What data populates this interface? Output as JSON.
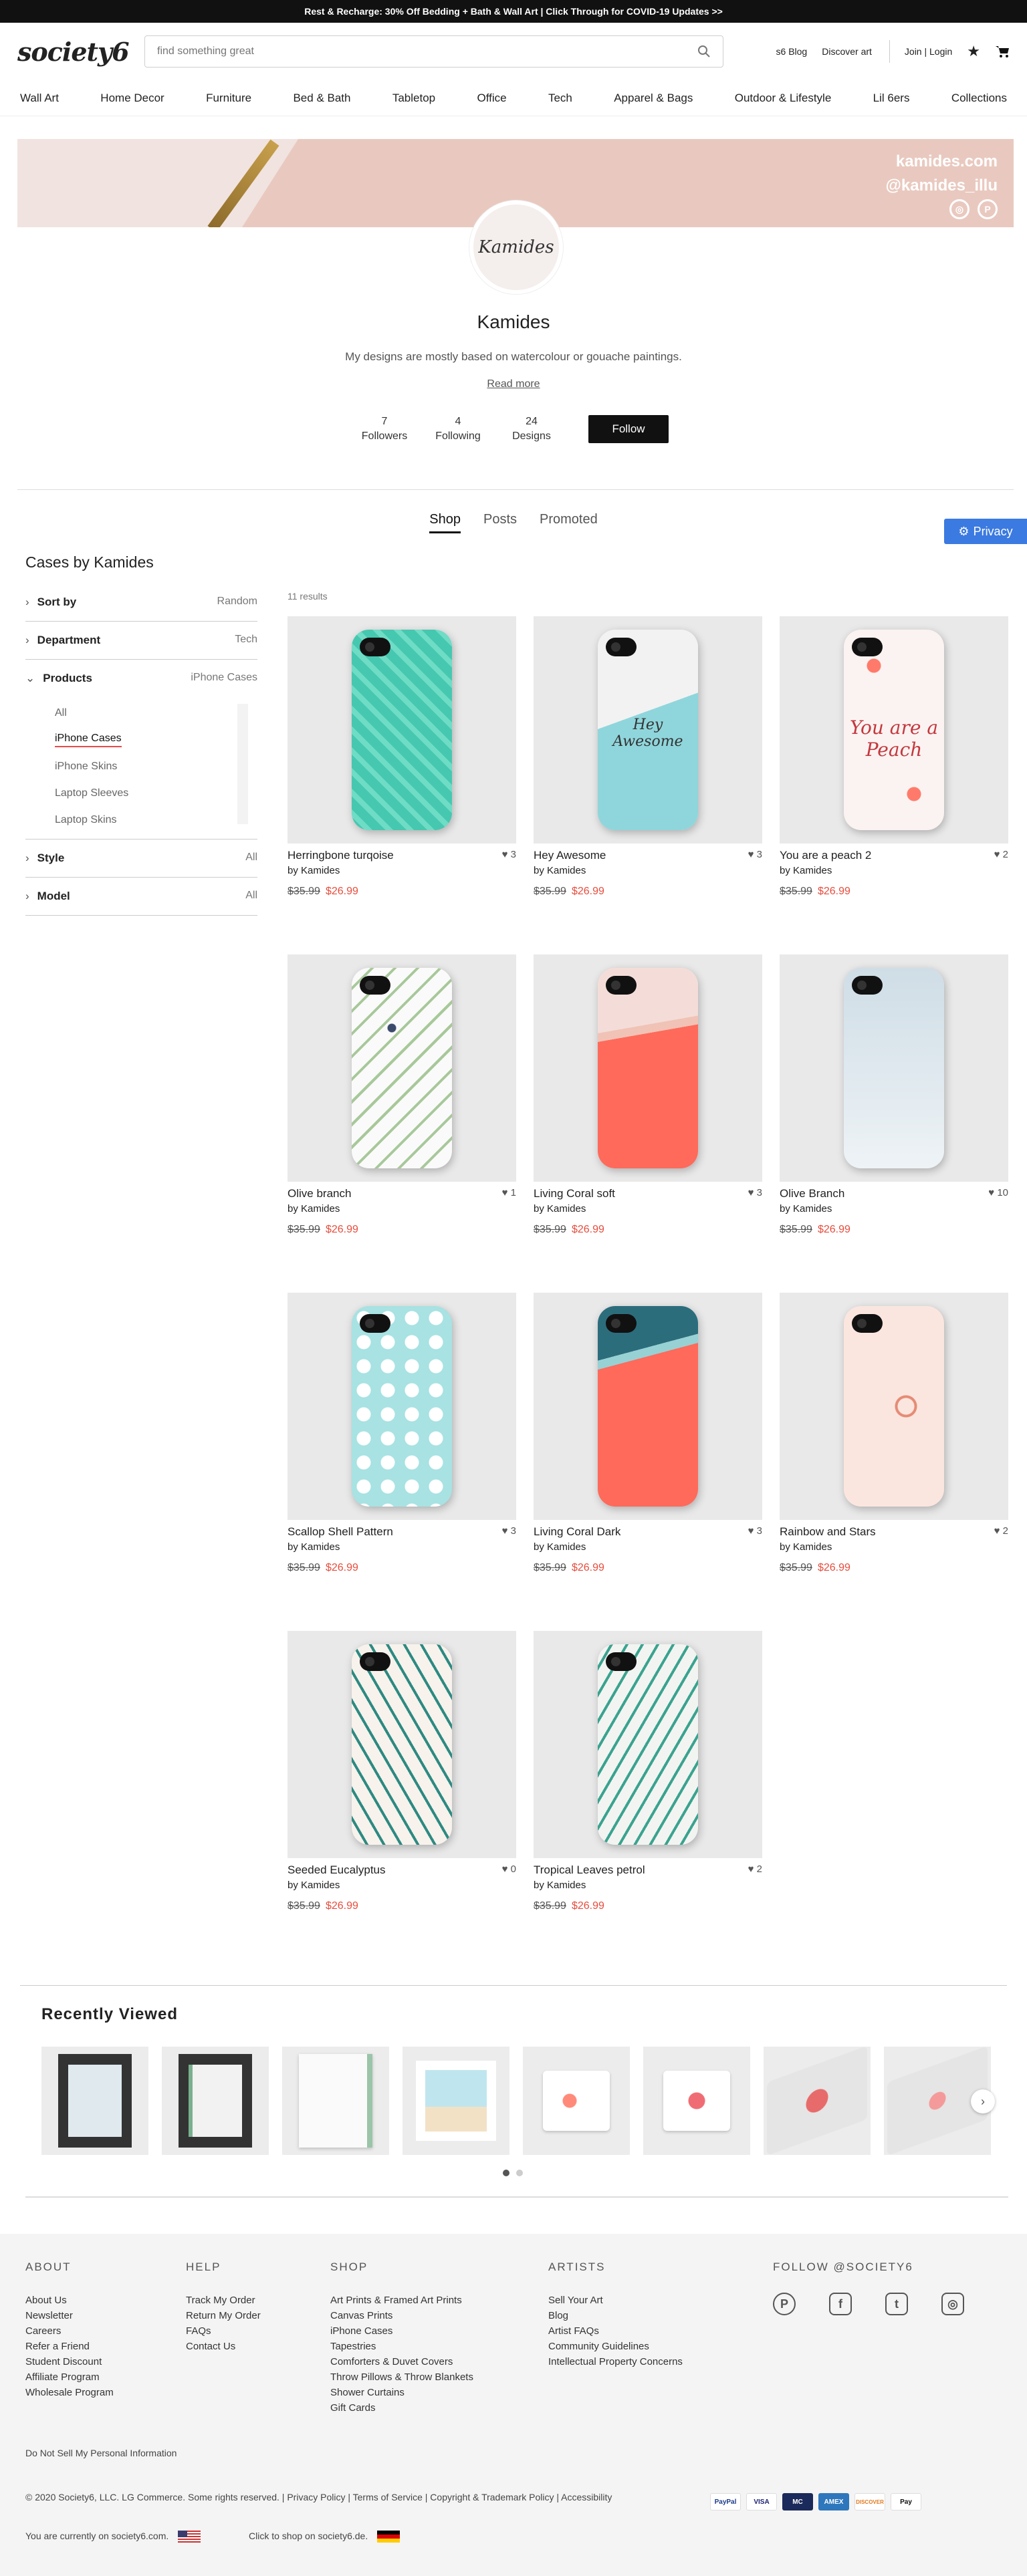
{
  "promo": "Rest & Recharge: 30% Off Bedding + Bath & Wall Art | Click Through for COVID-19 Updates >>",
  "header": {
    "logo": "society6",
    "search_placeholder": "find something great",
    "blog": "s6 Blog",
    "discover": "Discover art",
    "login": "Join | Login"
  },
  "nav": [
    "Wall Art",
    "Home Decor",
    "Furniture",
    "Bed & Bath",
    "Tabletop",
    "Office",
    "Tech",
    "Apparel & Bags",
    "Outdoor & Lifestyle",
    "Lil 6ers",
    "Collections"
  ],
  "banner": {
    "site": "kamides.com",
    "handle": "@kamides_illu"
  },
  "profile": {
    "avatar_text": "Kamides",
    "name": "Kamides",
    "bio": "My designs are mostly based on watercolour or gouache paintings.",
    "read_more": "Read more",
    "stats": [
      {
        "value": "7",
        "label": "Followers"
      },
      {
        "value": "4",
        "label": "Following"
      },
      {
        "value": "24",
        "label": "Designs"
      }
    ],
    "follow": "Follow"
  },
  "tabs": [
    "Shop",
    "Posts",
    "Promoted"
  ],
  "privacy": "Privacy",
  "sidebar": {
    "title": "Cases by Kamides",
    "sort": {
      "label": "Sort by",
      "value": "Random"
    },
    "department": {
      "label": "Department",
      "value": "Tech"
    },
    "products": {
      "label": "Products",
      "value": "iPhone Cases",
      "options": [
        "All",
        "iPhone Cases",
        "iPhone Skins",
        "Laptop Sleeves",
        "Laptop Skins"
      ]
    },
    "style": {
      "label": "Style",
      "value": "All"
    },
    "model": {
      "label": "Model",
      "value": "All"
    }
  },
  "results": "11 results",
  "products": [
    {
      "title": "Herringbone turqoise",
      "by": "by Kamides",
      "likes": "3",
      "old": "$35.99",
      "new": "$26.99",
      "bg": "#46c8b0",
      "pattern": "herring",
      "word": ""
    },
    {
      "title": "Hey Awesome",
      "by": "by Kamides",
      "likes": "3",
      "old": "$35.99",
      "new": "$26.99",
      "bg": "#8fd6dc",
      "pattern": "marble",
      "word": "Hey Awesome"
    },
    {
      "title": "You are a peach 2",
      "by": "by Kamides",
      "likes": "2",
      "old": "$35.99",
      "new": "$26.99",
      "bg": "#fbf3f1",
      "pattern": "peach",
      "word": "You are a Peach"
    },
    {
      "title": "Olive branch",
      "by": "by Kamides",
      "likes": "1",
      "old": "$35.99",
      "new": "$26.99",
      "bg": "#fafafa",
      "pattern": "olive",
      "word": ""
    },
    {
      "title": "Living Coral soft",
      "by": "by Kamides",
      "likes": "3",
      "old": "$35.99",
      "new": "$26.99",
      "bg": "#ff6a5b",
      "pattern": "coralsoft",
      "word": ""
    },
    {
      "title": "Olive Branch",
      "by": "by Kamides",
      "likes": "10",
      "old": "$35.99",
      "new": "$26.99",
      "bg": "#cfdde6",
      "pattern": "sky",
      "word": ""
    },
    {
      "title": "Scallop Shell Pattern",
      "by": "by Kamides",
      "likes": "3",
      "old": "$35.99",
      "new": "$26.99",
      "bg": "#a8e2e3",
      "pattern": "shell",
      "word": ""
    },
    {
      "title": "Living Coral Dark",
      "by": "by Kamides",
      "likes": "3",
      "old": "$35.99",
      "new": "$26.99",
      "bg": "#ff6a5b",
      "pattern": "coraldark",
      "word": ""
    },
    {
      "title": "Rainbow and Stars",
      "by": "by Kamides",
      "likes": "2",
      "old": "$35.99",
      "new": "$26.99",
      "bg": "#fbe6df",
      "pattern": "rainbow",
      "word": ""
    },
    {
      "title": "Seeded Eucalyptus",
      "by": "by Kamides",
      "likes": "0",
      "old": "$35.99",
      "new": "$26.99",
      "bg": "#f7f2ec",
      "pattern": "euca",
      "word": ""
    },
    {
      "title": "Tropical Leaves petrol",
      "by": "by Kamides",
      "likes": "2",
      "old": "$35.99",
      "new": "$26.99",
      "bg": "#f2f4f2",
      "pattern": "tropic",
      "word": ""
    }
  ],
  "recently": {
    "title": "Recently Viewed",
    "items": [
      "framed-print-olive",
      "framed-print-leaf",
      "art-print-eucalyptus",
      "art-print-beach",
      "mug-peach",
      "mug-watermelon",
      "laptop-skin-coral",
      "laptop-skin-flower"
    ]
  },
  "footer": {
    "about": {
      "title": "ABOUT",
      "links": [
        "About Us",
        "Newsletter",
        "Careers",
        "Refer a Friend",
        "Student Discount",
        "Affiliate Program",
        "Wholesale Program"
      ]
    },
    "help": {
      "title": "HELP",
      "links": [
        "Track My Order",
        "Return My Order",
        "FAQs",
        "Contact Us"
      ]
    },
    "shop": {
      "title": "SHOP",
      "links": [
        "Art Prints & Framed Art Prints",
        "Canvas Prints",
        "iPhone Cases",
        "Tapestries",
        "Comforters & Duvet Covers",
        "Throw Pillows & Throw Blankets",
        "Shower Curtains",
        "Gift Cards"
      ]
    },
    "artists": {
      "title": "ARTISTS",
      "links": [
        "Sell Your Art",
        "Blog",
        "Artist FAQs",
        "Community Guidelines",
        "Intellectual Property Concerns"
      ]
    },
    "follow": {
      "title": "FOLLOW @SOCIETY6"
    },
    "dnsmpi": "Do Not Sell My Personal Information",
    "copyright": "© 2020 Society6, LLC. LG Commerce. Some rights reserved. | Privacy Policy | Terms of Service | Copyright & Trademark Policy | Accessibility",
    "locale1": "You are currently on society6.com.",
    "locale2": "Click to shop on society6.de.",
    "payments": [
      "PayPal",
      "VISA",
      "MC",
      "AMEX",
      "DISCOVER",
      "Pay"
    ]
  },
  "colors": {
    "accent": "#e74c3c",
    "privacy": "#3b7ae0"
  }
}
